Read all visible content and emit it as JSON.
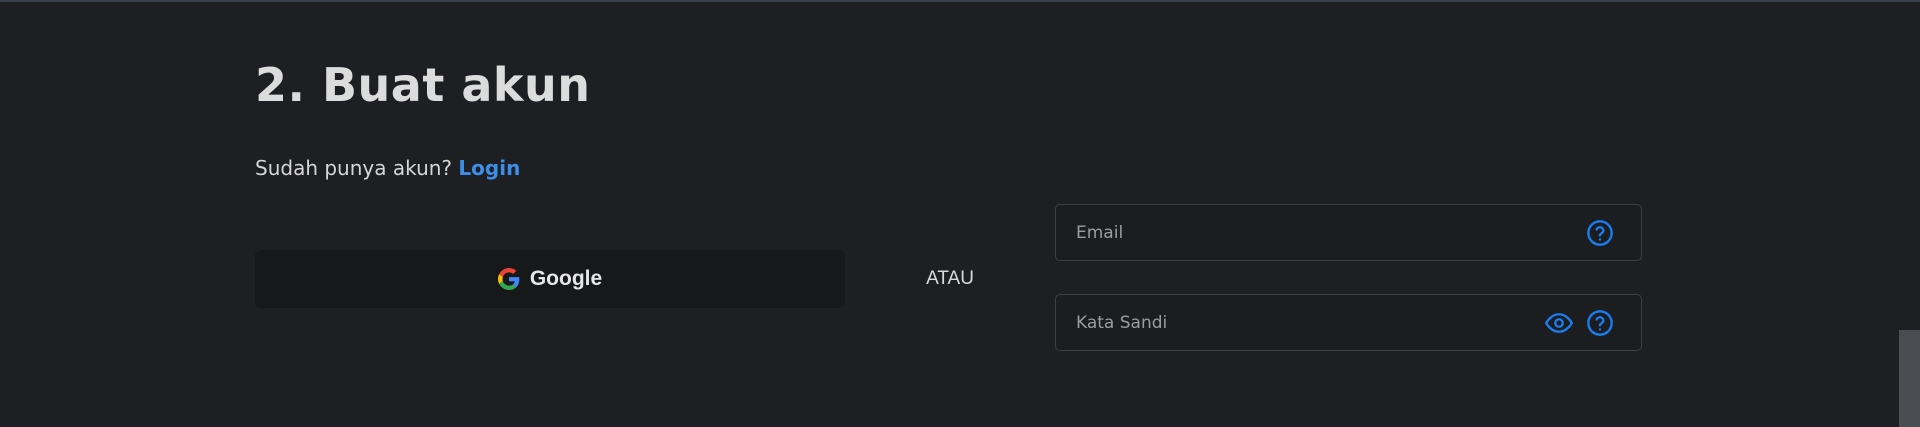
{
  "section": {
    "title": "2. Buat akun"
  },
  "login_prompt": {
    "text": "Sudah punya akun?",
    "link_label": "Login"
  },
  "google_button": {
    "label": "Google",
    "icon": "google-icon"
  },
  "divider": {
    "label": "ATAU"
  },
  "email_field": {
    "placeholder": "Email",
    "value": "",
    "help_icon": "question-circle-icon"
  },
  "password_field": {
    "placeholder": "Kata Sandi",
    "value": "",
    "toggle_icon": "eye-icon",
    "help_icon": "question-circle-icon"
  },
  "colors": {
    "background": "#1e1f22",
    "accent": "#3d8ee8",
    "icon_blue": "#1a7ef0"
  }
}
